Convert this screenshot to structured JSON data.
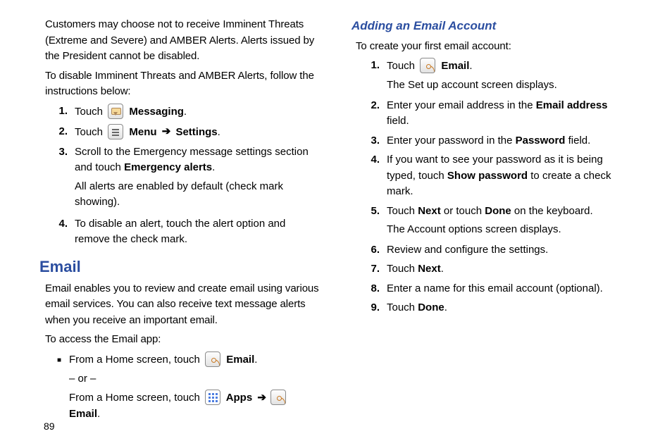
{
  "pageNumber": "89",
  "col1": {
    "intro1": "Customers may choose not to receive Imminent Threats (Extreme and Severe) and AMBER Alerts. Alerts issued by the President cannot be disabled.",
    "intro2": "To disable Imminent Threats and AMBER Alerts, follow the instructions below:",
    "list1": {
      "n1": "1.",
      "i1a": "Touch ",
      "i1b": " Messaging",
      "i1c": ".",
      "n2": "2.",
      "i2a": "Touch ",
      "i2b": " Menu ",
      "i2c": " Settings",
      "i2d": ".",
      "n3": "3.",
      "i3a": "Scroll to the Emergency message settings section and touch ",
      "i3b": "Emergency alerts",
      "i3c": ".",
      "i3sub": "All alerts are enabled by default (check mark showing).",
      "n4": "4.",
      "i4": "To disable an alert, touch the alert option and remove the check mark."
    },
    "h1": "Email",
    "emailIntro1": "Email enables you to review and create email using various email services. You can also receive text message alerts when you receive an important email.",
    "emailIntro2": "To access the Email app:",
    "bullet": {
      "b1a": "From a Home screen, touch ",
      "b1b": " Email",
      "b1c": ".",
      "or": "– or –",
      "b2a": "From a Home screen, touch ",
      "b2b": " Apps ",
      "b2c": " Email",
      "b2d": "."
    }
  },
  "col2": {
    "h2": "Adding an Email Account",
    "intro": "To create your first email account:",
    "list": {
      "n1": "1.",
      "i1a": "Touch ",
      "i1b": " Email",
      "i1c": ".",
      "i1sub": "The Set up account screen displays.",
      "n2": "2.",
      "i2a": "Enter your email address in the ",
      "i2b": "Email address",
      "i2c": " field.",
      "n3": "3.",
      "i3a": "Enter your password in the ",
      "i3b": "Password",
      "i3c": " field.",
      "n4": "4.",
      "i4a": "If you want to see your password as it is being typed, touch ",
      "i4b": "Show password",
      "i4c": " to create a check mark.",
      "n5": "5.",
      "i5a": "Touch ",
      "i5b": "Next",
      "i5c": " or touch ",
      "i5d": "Done",
      "i5e": " on the keyboard.",
      "i5sub": "The Account options screen displays.",
      "n6": "6.",
      "i6": "Review and configure the settings.",
      "n7": "7.",
      "i7a": "Touch ",
      "i7b": "Next",
      "i7c": ".",
      "n8": "8.",
      "i8": "Enter a name for this email account (optional).",
      "n9": "9.",
      "i9a": "Touch ",
      "i9b": "Done",
      "i9c": "."
    }
  }
}
